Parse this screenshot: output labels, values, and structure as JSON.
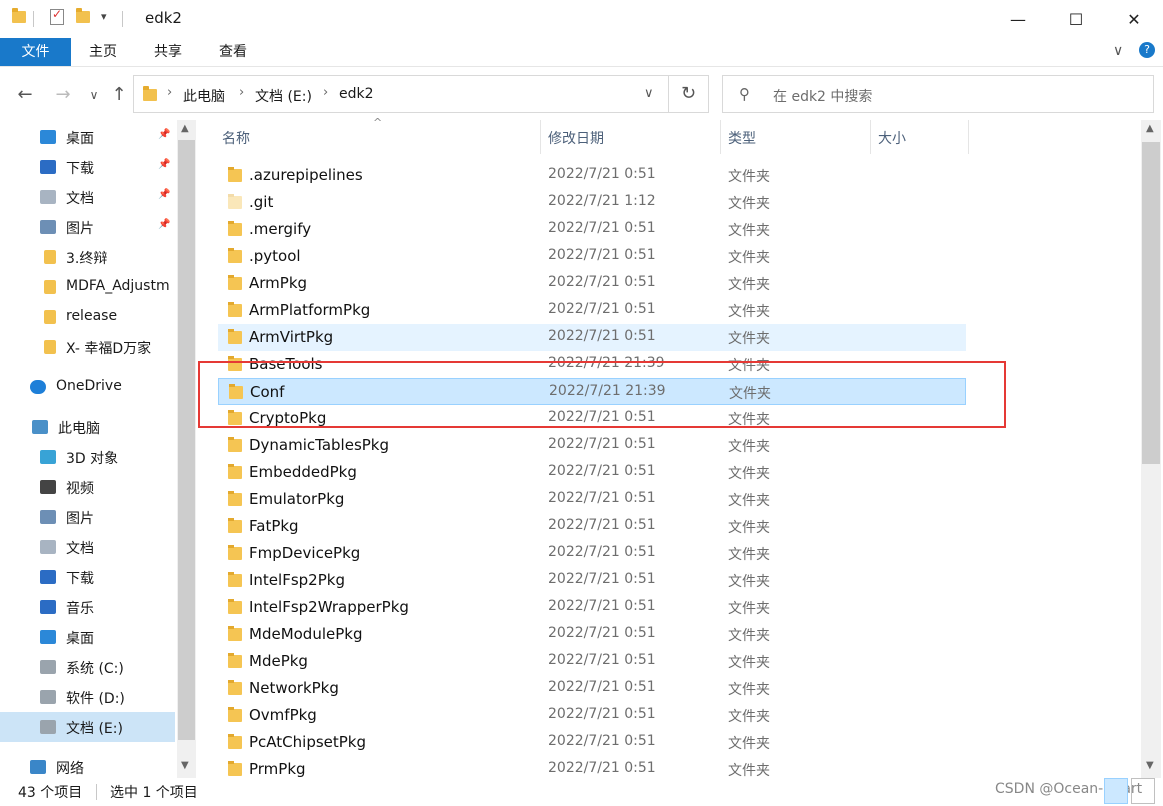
{
  "window": {
    "title": "edk2",
    "minimize": "—",
    "maximize": "☐",
    "close": "✕"
  },
  "ribbon": {
    "tabs": [
      "文件",
      "主页",
      "共享",
      "查看"
    ]
  },
  "address": {
    "crumbs": [
      "此电脑",
      "文档 (E:)",
      "edk2"
    ],
    "search_placeholder": "在 edk2 中搜索"
  },
  "nav": {
    "items": [
      {
        "label": "桌面",
        "icon": "desktop-icon",
        "pinned": true
      },
      {
        "label": "下载",
        "icon": "download-icon",
        "pinned": true
      },
      {
        "label": "文档",
        "icon": "document-icon",
        "pinned": true
      },
      {
        "label": "图片",
        "icon": "picture-icon",
        "pinned": true
      },
      {
        "label": "3.终辩",
        "icon": "folder-icon"
      },
      {
        "label": "MDFA_Adjustm",
        "icon": "folder-icon"
      },
      {
        "label": "release",
        "icon": "folder-icon"
      },
      {
        "label": "X- 幸福D万家",
        "icon": "folder-icon"
      },
      {
        "label": "OneDrive",
        "icon": "cloud-icon"
      },
      {
        "label": "此电脑",
        "icon": "computer-icon"
      },
      {
        "label": "3D 对象",
        "icon": "cube-icon"
      },
      {
        "label": "视频",
        "icon": "video-icon"
      },
      {
        "label": "图片",
        "icon": "picture-icon"
      },
      {
        "label": "文档",
        "icon": "document-icon"
      },
      {
        "label": "下载",
        "icon": "download-icon"
      },
      {
        "label": "音乐",
        "icon": "music-icon"
      },
      {
        "label": "桌面",
        "icon": "desktop-icon"
      },
      {
        "label": "系统 (C:)",
        "icon": "drive-icon"
      },
      {
        "label": "软件 (D:)",
        "icon": "drive-icon"
      },
      {
        "label": "文档 (E:)",
        "icon": "drive-icon",
        "selected": true
      },
      {
        "label": "网络",
        "icon": "network-icon"
      }
    ]
  },
  "columns": {
    "name": "名称",
    "date": "修改日期",
    "type": "类型",
    "size": "大小"
  },
  "files": [
    {
      "name": ".azurepipelines",
      "date": "2022/7/21 0:51",
      "type": "文件夹"
    },
    {
      "name": ".git",
      "date": "2022/7/21 1:12",
      "type": "文件夹",
      "hidden": true
    },
    {
      "name": ".mergify",
      "date": "2022/7/21 0:51",
      "type": "文件夹"
    },
    {
      "name": ".pytool",
      "date": "2022/7/21 0:51",
      "type": "文件夹"
    },
    {
      "name": "ArmPkg",
      "date": "2022/7/21 0:51",
      "type": "文件夹"
    },
    {
      "name": "ArmPlatformPkg",
      "date": "2022/7/21 0:51",
      "type": "文件夹"
    },
    {
      "name": "ArmVirtPkg",
      "date": "2022/7/21 0:51",
      "type": "文件夹",
      "state": "hover"
    },
    {
      "name": "BaseTools",
      "date": "2022/7/21 21:39",
      "type": "文件夹"
    },
    {
      "name": "Conf",
      "date": "2022/7/21 21:39",
      "type": "文件夹",
      "state": "selected"
    },
    {
      "name": "CryptoPkg",
      "date": "2022/7/21 0:51",
      "type": "文件夹"
    },
    {
      "name": "DynamicTablesPkg",
      "date": "2022/7/21 0:51",
      "type": "文件夹"
    },
    {
      "name": "EmbeddedPkg",
      "date": "2022/7/21 0:51",
      "type": "文件夹"
    },
    {
      "name": "EmulatorPkg",
      "date": "2022/7/21 0:51",
      "type": "文件夹"
    },
    {
      "name": "FatPkg",
      "date": "2022/7/21 0:51",
      "type": "文件夹"
    },
    {
      "name": "FmpDevicePkg",
      "date": "2022/7/21 0:51",
      "type": "文件夹"
    },
    {
      "name": "IntelFsp2Pkg",
      "date": "2022/7/21 0:51",
      "type": "文件夹"
    },
    {
      "name": "IntelFsp2WrapperPkg",
      "date": "2022/7/21 0:51",
      "type": "文件夹"
    },
    {
      "name": "MdeModulePkg",
      "date": "2022/7/21 0:51",
      "type": "文件夹"
    },
    {
      "name": "MdePkg",
      "date": "2022/7/21 0:51",
      "type": "文件夹"
    },
    {
      "name": "NetworkPkg",
      "date": "2022/7/21 0:51",
      "type": "文件夹"
    },
    {
      "name": "OvmfPkg",
      "date": "2022/7/21 0:51",
      "type": "文件夹"
    },
    {
      "name": "PcAtChipsetPkg",
      "date": "2022/7/21 0:51",
      "type": "文件夹"
    },
    {
      "name": "PrmPkg",
      "date": "2022/7/21 0:51",
      "type": "文件夹"
    }
  ],
  "status": {
    "count": "43 个项目",
    "selected": "选中 1 个项目"
  },
  "watermark": "CSDN @Ocean-Heart",
  "colors": {
    "accent": "#1979ca",
    "selection": "#cce8ff",
    "highlight_box": "#e53935"
  }
}
